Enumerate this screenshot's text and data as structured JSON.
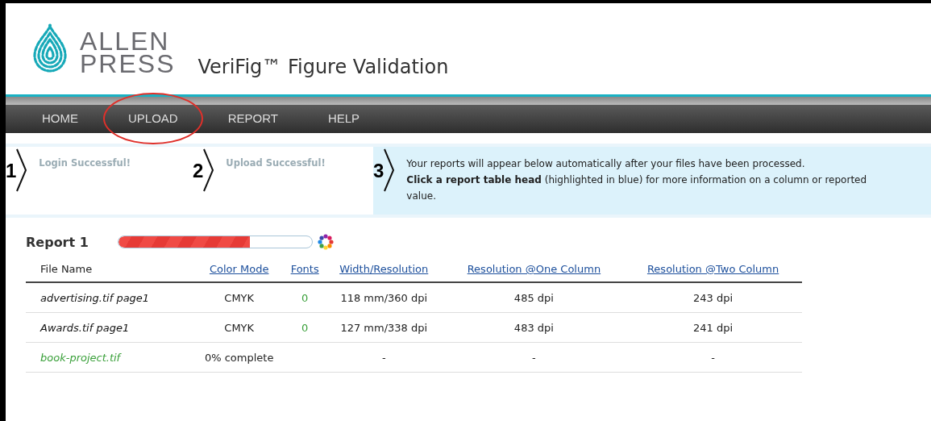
{
  "brand": {
    "name_line1": "ALLEN",
    "name_line2": "PRESS",
    "app_title": "VeriFig™ Figure Validation"
  },
  "nav": [
    {
      "label": "HOME",
      "highlighted": false
    },
    {
      "label": "UPLOAD",
      "highlighted": true
    },
    {
      "label": "REPORT",
      "highlighted": false
    },
    {
      "label": "HELP",
      "highlighted": false
    }
  ],
  "steps": [
    {
      "number": "1",
      "text": "Login Successful!",
      "current": false
    },
    {
      "number": "2",
      "text": "Upload Successful!",
      "current": false
    },
    {
      "number": "3",
      "current": true,
      "lines": [
        "Your reports will appear below automatically after your files have been processed.",
        "**Click a report table head** (highlighted in blue) for more information on a column or reported value."
      ]
    }
  ],
  "report": {
    "title": "Report 1",
    "level": 0.68,
    "columns": [
      {
        "label": "File Name",
        "kind": "plain"
      },
      {
        "label": "Color Mode",
        "kind": "link"
      },
      {
        "label": "Fonts",
        "kind": "link"
      },
      {
        "label": "Width/Resolution",
        "kind": "link"
      },
      {
        "label": "Resolution @One Column",
        "kind": "link"
      },
      {
        "label": "Resolution @Two Column",
        "kind": "link"
      }
    ],
    "rows": [
      {
        "kind": "done",
        "cells": [
          "advertising.tif page1",
          "CMYK",
          "0",
          "118 mm/360 dpi",
          "485 dpi",
          "243 dpi"
        ]
      },
      {
        "kind": "done",
        "cells": [
          "Awards.tif page1",
          "CMYK",
          "0",
          "127 mm/338 dpi",
          "483 dpi",
          "241 dpi"
        ]
      },
      {
        "kind": "processing",
        "cells": [
          "book-project.tif",
          "0% complete",
          "",
          "-",
          "-",
          "-"
        ]
      }
    ]
  }
}
